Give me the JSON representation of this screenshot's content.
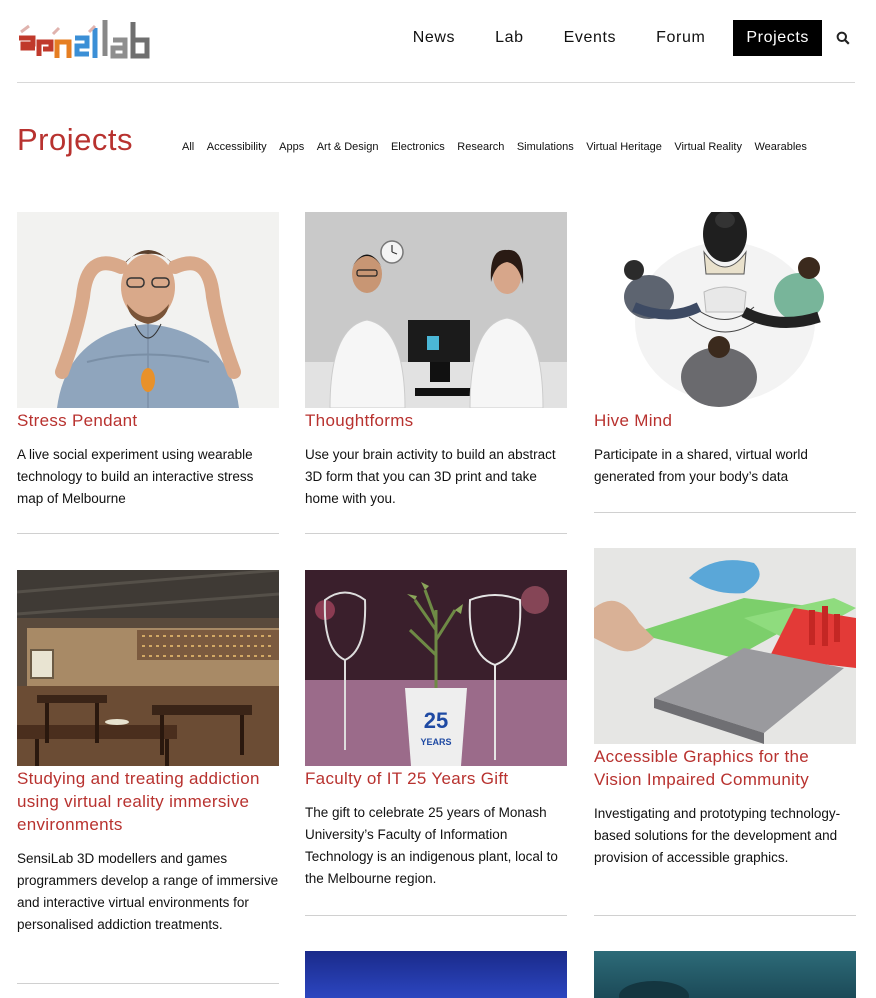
{
  "brand": {
    "logo_text": "sensilab"
  },
  "nav": {
    "items": [
      "News",
      "Lab",
      "Events",
      "Forum"
    ],
    "active": "Projects",
    "search_icon": "search-icon"
  },
  "page": {
    "title": "Projects"
  },
  "filters": [
    "All",
    "Accessibility",
    "Apps",
    "Art & Design",
    "Electronics",
    "Research",
    "Simulations",
    "Virtual Heritage",
    "Virtual Reality",
    "Wearables"
  ],
  "projects": [
    {
      "title": "Stress Pendant",
      "desc": "A live social experiment using wearable technology to build an interactive stress map of Melbourne"
    },
    {
      "title": "Thoughtforms",
      "desc": "Use your brain activity to build an abstract 3D form that you can 3D print and take home with you."
    },
    {
      "title": "Hive Mind",
      "desc": "Participate in a shared, virtual world generated from your body’s data"
    },
    {
      "title": "Studying and treating addiction using virtual reality immersive environments",
      "desc": "SensiLab 3D modellers and games programmers develop a range of immersive and interactive virtual environments for personalised addiction treatments."
    },
    {
      "title": "Faculty of IT 25 Years Gift",
      "desc": "The gift to celebrate 25 years of Monash University’s Faculty of Information Technology is an indigenous plant, local to the Melbourne region.",
      "badge_number": "25",
      "badge_text": "YEARS"
    },
    {
      "title": "Accessible Graphics for the Vision Impaired Community",
      "desc": "Investigating and prototyping technology-based solutions for the development and provision of accessible graphics."
    }
  ],
  "colors": {
    "accent": "#b8322f",
    "nav_active_bg": "#000000"
  }
}
